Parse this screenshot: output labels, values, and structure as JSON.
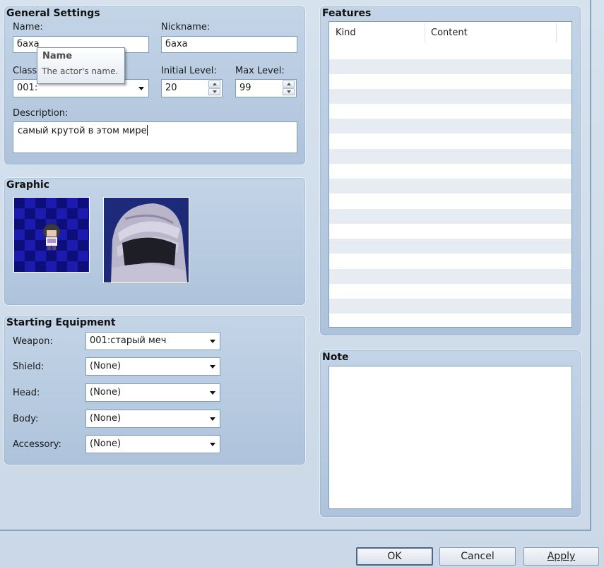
{
  "general": {
    "title": "General Settings",
    "name_label": "Name:",
    "name_value": "баха",
    "nickname_label": "Nickname:",
    "nickname_value": "баха",
    "class_label": "Class",
    "class_value": "001:",
    "initial_level_label": "Initial Level:",
    "initial_level_value": "20",
    "max_level_label": "Max Level:",
    "max_level_value": "99",
    "description_label": "Description:",
    "description_value": "самый крутой в этом мире"
  },
  "tooltip": {
    "title": "Name",
    "body": "The actor's name."
  },
  "graphic": {
    "title": "Graphic",
    "character_icon": "chibi-character-sprite",
    "face_icon": "hooded-face-portrait"
  },
  "equipment": {
    "title": "Starting Equipment",
    "weapon_label": "Weapon:",
    "weapon_value": "001:старый меч",
    "shield_label": "Shield:",
    "shield_value": "(None)",
    "head_label": "Head:",
    "head_value": "(None)",
    "body_label": "Body:",
    "body_value": "(None)",
    "accessory_label": "Accessory:",
    "accessory_value": "(None)"
  },
  "features": {
    "title": "Features",
    "col_kind": "Kind",
    "col_content": "Content"
  },
  "note": {
    "title": "Note",
    "value": ""
  },
  "buttons": {
    "ok": "OK",
    "cancel": "Cancel",
    "apply": "Apply"
  },
  "colors": {
    "panel": "#b6c9df",
    "accent_border": "#4d6788"
  }
}
